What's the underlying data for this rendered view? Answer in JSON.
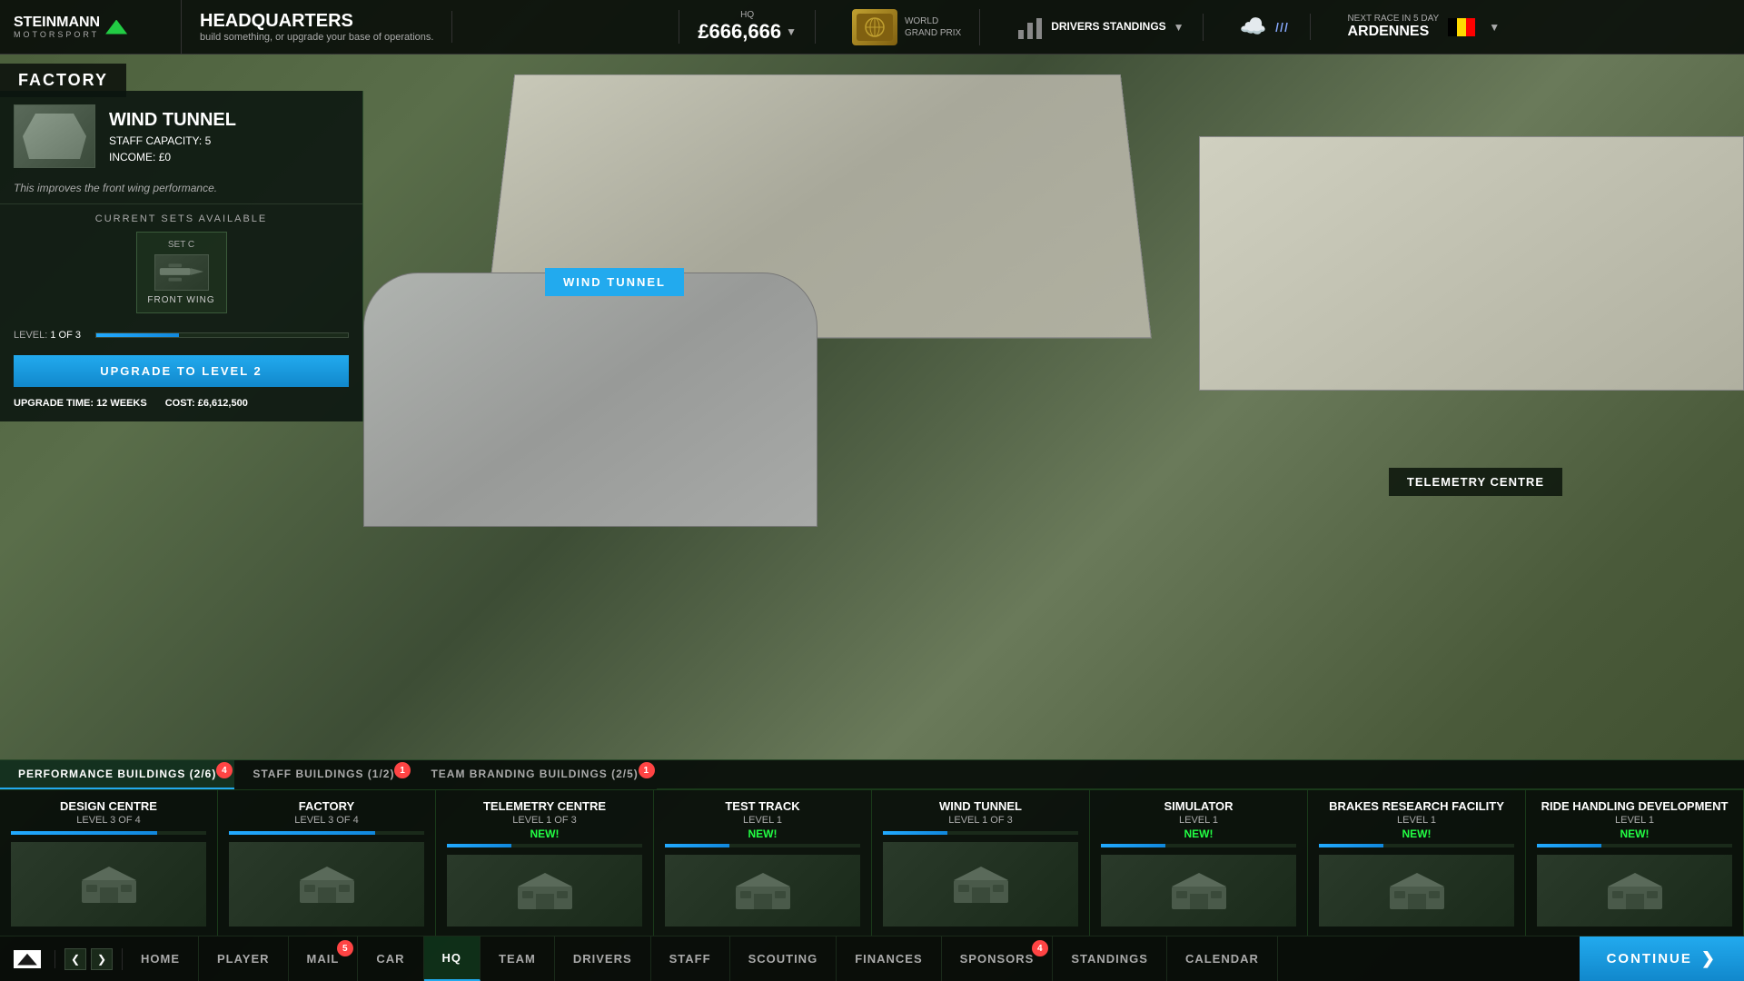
{
  "app": {
    "logo_line1": "STEINMANN",
    "logo_line2": "MOTORSPORT"
  },
  "header": {
    "title": "HEADQUARTERS",
    "subtitle": "build something, or upgrade your base of operations.",
    "hq_label": "HQ",
    "money": "£666,666",
    "world_gp": "WORLD\nGRAND PRIX",
    "drivers_standings": "DRIVERS\nSTANDINGS",
    "next_race_label": "NEXT RACE IN 5 DAY",
    "next_race_location": "ARDENNES"
  },
  "factory_label": "FACTORY",
  "left_panel": {
    "building_name": "WIND TUNNEL",
    "staff_capacity_label": "STAFF CAPACITY:",
    "staff_capacity": "5",
    "income_label": "INCOME:",
    "income": "£0",
    "description": "This improves the front wing performance.",
    "current_sets_label": "CURRENT SETS AVAILABLE",
    "set_label": "SET C",
    "set_part": "FRONT WING",
    "level_label": "Level:",
    "level_value": "1 OF 3",
    "upgrade_btn": "UPGRADE TO LEVEL 2",
    "upgrade_time_label": "UPGRADE TIME:",
    "upgrade_time": "12 WEEKS",
    "cost_label": "COST:",
    "cost": "£6,612,500"
  },
  "map_labels": {
    "wind_tunnel": "WIND TUNNEL",
    "telemetry_centre": "TELEMETRY CENTRE"
  },
  "bottom_bar": {
    "categories": [
      {
        "label": "PERFORMANCE BUILDINGS (2/6)",
        "active": true,
        "badge": 4
      },
      {
        "label": "STAFF BUILDINGS (1/2)",
        "active": false,
        "badge": 1
      },
      {
        "label": "TEAM BRANDING BUILDINGS (2/5)",
        "active": false,
        "badge": 1
      }
    ],
    "buildings": [
      {
        "name": "Design Centre",
        "level": "LEVEL 3 OF 4",
        "new": false,
        "bar_pct": 75
      },
      {
        "name": "Factory",
        "level": "LEVEL 3 OF 4",
        "new": false,
        "bar_pct": 75
      },
      {
        "name": "Telemetry Centre",
        "level": "LEVEL 1 OF 3",
        "new": true,
        "bar_pct": 33
      },
      {
        "name": "Test Track",
        "level": "LEVEL 1",
        "new": true,
        "bar_pct": 33
      },
      {
        "name": "Wind Tunnel",
        "level": "LEVEL 1 OF 3",
        "new": false,
        "bar_pct": 33
      },
      {
        "name": "Simulator",
        "level": "LEVEL 1",
        "new": true,
        "bar_pct": 33
      },
      {
        "name": "Brakes Research Facility",
        "level": "LEVEL 1",
        "new": true,
        "bar_pct": 33
      },
      {
        "name": "Ride Handling Development",
        "level": "LEVEL 1",
        "new": true,
        "bar_pct": 33
      }
    ]
  },
  "nav": {
    "items": [
      {
        "label": "Home",
        "active": false,
        "badge": 0
      },
      {
        "label": "Player",
        "active": false,
        "badge": 0
      },
      {
        "label": "Mail",
        "active": false,
        "badge": 5
      },
      {
        "label": "Car",
        "active": false,
        "badge": 0
      },
      {
        "label": "HQ",
        "active": true,
        "badge": 0
      },
      {
        "label": "Team",
        "active": false,
        "badge": 0
      },
      {
        "label": "Drivers",
        "active": false,
        "badge": 0
      },
      {
        "label": "Staff",
        "active": false,
        "badge": 0
      },
      {
        "label": "Scouting",
        "active": false,
        "badge": 0
      },
      {
        "label": "Finances",
        "active": false,
        "badge": 0
      },
      {
        "label": "Sponsors",
        "active": false,
        "badge": 4
      },
      {
        "label": "Standings",
        "active": false,
        "badge": 0
      },
      {
        "label": "Calendar",
        "active": false,
        "badge": 0
      }
    ],
    "continue_label": "Continue"
  },
  "icons": {
    "chevron_down": "▼",
    "chevron_right": "❯",
    "chevron_left": "❮",
    "cloud": "☁",
    "rain": "🌧"
  }
}
